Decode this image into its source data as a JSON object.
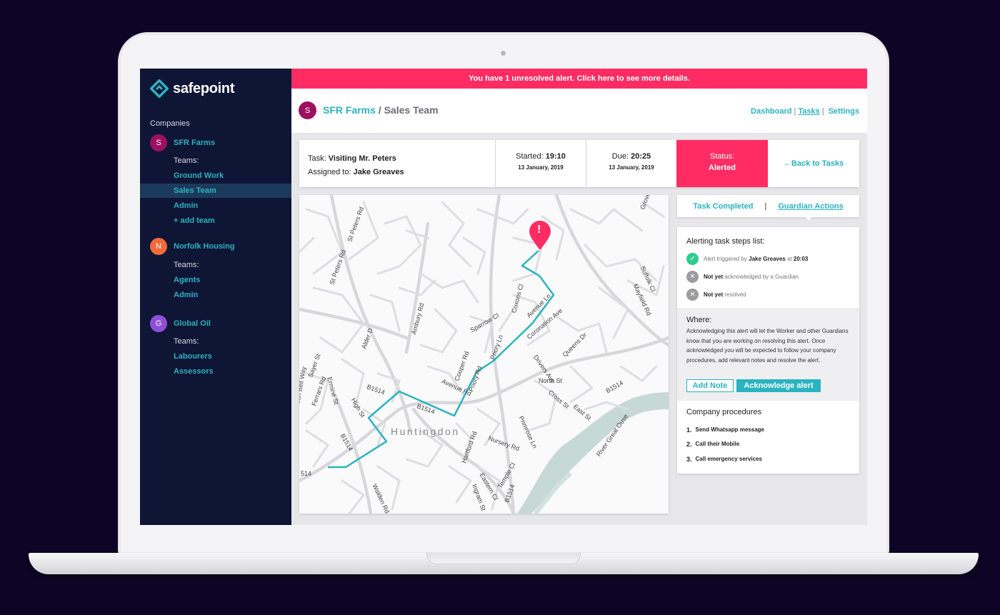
{
  "app": {
    "name": "safepoint"
  },
  "sidebar": {
    "companies_label": "Companies",
    "companies": [
      {
        "initial": "S",
        "name": "SFR Farms",
        "color": "#9c1060",
        "teams_label": "Teams:",
        "teams": [
          "Ground Work",
          "Sales Team",
          "Admin",
          "+ add team"
        ],
        "active_team": "Sales Team"
      },
      {
        "initial": "N",
        "name": "Norfolk Housing",
        "color": "#f26b3a",
        "teams_label": "Teams:",
        "teams": [
          "Agents",
          "Admin"
        ]
      },
      {
        "initial": "G",
        "name": "Global Oil",
        "color": "#8e4fd8",
        "teams_label": "Teams:",
        "teams": [
          "Labourers",
          "Assessors"
        ]
      }
    ]
  },
  "alert_banner": "You have 1 unresolved alert. Click here to see more details.",
  "header": {
    "avatar_initial": "S",
    "company": "SFR Farms",
    "separator": " / ",
    "team": "Sales Team",
    "nav": {
      "dashboard": "Dashboard",
      "tasks": "Tasks",
      "settings": "Settings",
      "pipe": "|"
    }
  },
  "task": {
    "task_label": "Task:",
    "task_name": "Visiting Mr. Peters",
    "assigned_label": "Assigned to:",
    "assigned_name": "Jake Greaves",
    "started_label": "Started:",
    "started_time": "19:10",
    "started_date": "13 January, 2019",
    "due_label": "Due:",
    "due_time": "20:25",
    "due_date": "13 January, 2019",
    "status_label": "Status:",
    "status_value": "Alerted",
    "back_label": "←Back to Tasks"
  },
  "map": {
    "town": "Huntingdon",
    "route_color": "#2bb3c0",
    "pin_color": "#ff2c63",
    "pin_glyph": "!",
    "labels": [
      "St Peters Rd",
      "St Peters Rd",
      "Ermine St",
      "Alder D",
      "Sayer St",
      "Ambury Rd",
      "Sparrow Cl",
      "Priory Ln",
      "Cooper Rd",
      "Coronation Ave",
      "Drivers Ave",
      "Queens Dr",
      "Avenue Rd",
      "Priory Rd",
      "B1514",
      "B1514",
      "B1514",
      "B1514",
      "Nursery Rd",
      "Primrose Ln",
      "North St",
      "Cross St",
      "East St",
      "River Great Ouse",
      "Hartford Rd",
      "Eastern Cl",
      "Ingram St",
      "Temple Cl",
      "Walden Rd",
      "Mayfield Rd",
      "Suffolk Cl",
      "Coxons Cl",
      "Ferrars Rd",
      "High St",
      "Nelson Bell Way",
      "514",
      "Grove",
      "Avenue Ln",
      "B1514"
    ]
  },
  "tabs": {
    "completed": "Task Completed",
    "pipe": "|",
    "guardian": "Guardian Actions"
  },
  "panel": {
    "steps_title": "Alerting task steps list:",
    "steps": [
      {
        "status": "done",
        "icon": "check-icon",
        "prefix": "Alert triggered by ",
        "bold": "Jake Greaves",
        "middle": " at ",
        "bold2": "20:03"
      },
      {
        "status": "pending",
        "icon": "cross-icon",
        "bold": "Not yet",
        "rest": " acknowledged by a Guardian"
      },
      {
        "status": "pending",
        "icon": "cross-icon",
        "bold": "Not yet",
        "rest": " resolved"
      }
    ],
    "where_title": "Where:",
    "where_text": "Acknowledging this alert will let the Worker and other Guardians know that you are working on resolving this alert. Once acknowledged you will be expected to follow your company procedures, add relevant notes and resolve the alert.",
    "add_note": "Add Note",
    "acknowledge": "Acknowledge alert",
    "procedures_title": "Company procedures",
    "procedures": [
      {
        "num": "1.",
        "text": "Send Whatsapp message"
      },
      {
        "num": "2.",
        "text": "Call their Mobile"
      },
      {
        "num": "3.",
        "text": "Call emergency services"
      }
    ]
  }
}
